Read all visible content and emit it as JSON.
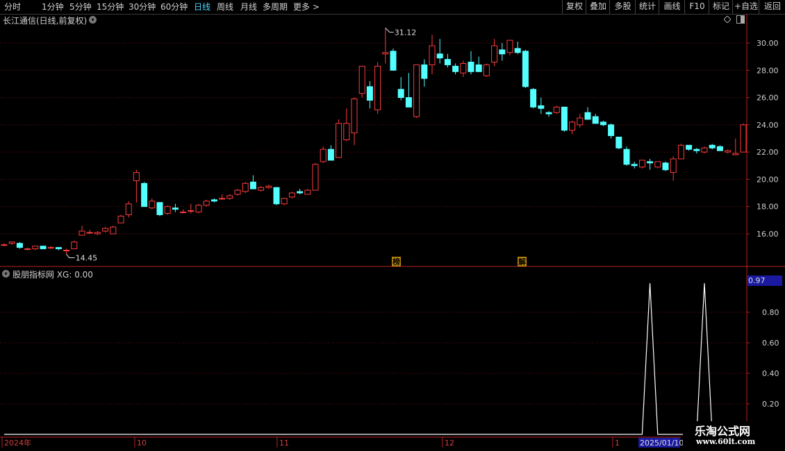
{
  "toolbar": {
    "periods": [
      "分时",
      "1分钟",
      "5分钟",
      "15分钟",
      "30分钟",
      "60分钟",
      "日线",
      "周线",
      "月线",
      "多周期",
      "更多 >"
    ],
    "active_period": "日线",
    "buttons": [
      "复权",
      "叠加",
      "多股",
      "统计",
      "画线",
      "F10",
      "标记",
      "+自选",
      "返回"
    ]
  },
  "chart": {
    "title": "长江通信(日线,前复权)",
    "y_ticks": [
      "30.00",
      "28.00",
      "26.00",
      "24.00",
      "22.00",
      "20.00",
      "18.00",
      "16.00"
    ],
    "high_label": "31.12",
    "low_label": "14.45",
    "marker_bang": "榜",
    "marker_jie": "解",
    "up_color": "#ff3c3c",
    "down_color": "#54ffff"
  },
  "indicator": {
    "title": "股朋指标网 XG: 0.00",
    "y_ticks": [
      "0.80",
      "0.60",
      "0.40",
      "0.20"
    ],
    "current_value": "0.97",
    "signal_values": [
      0,
      0,
      0,
      0,
      0,
      0,
      0,
      0,
      0,
      0,
      0,
      0,
      0,
      0,
      0,
      0,
      0,
      0,
      0,
      0,
      0,
      0,
      0,
      0,
      0,
      0,
      0,
      0,
      0,
      0,
      0,
      0,
      0,
      0,
      0,
      0,
      0,
      0,
      0,
      0,
      0,
      0,
      0,
      0,
      0,
      0,
      0,
      0,
      0,
      0,
      0,
      0,
      0,
      0,
      0,
      0,
      0,
      0,
      0,
      0,
      0,
      0,
      0,
      0,
      0,
      0,
      0,
      0,
      0,
      0,
      0,
      0,
      0,
      0,
      0,
      0,
      0,
      0,
      0,
      0,
      0,
      0,
      0,
      1,
      0,
      0,
      0,
      0,
      0,
      0,
      1,
      0,
      0,
      0,
      0,
      0,
      0,
      0,
      0,
      0
    ]
  },
  "x_axis": {
    "labels": [
      "2024年",
      "10",
      "11",
      "12",
      "1"
    ],
    "cursor_date": "2025/01/10"
  },
  "watermark": {
    "line1": "乐淘公式网",
    "line2": "www.60lt.com"
  },
  "chart_data": {
    "type": "candlestick",
    "ylim": [
      14.0,
      31.6
    ],
    "candles": [
      [
        15.2,
        15.3,
        15.1,
        15.2
      ],
      [
        15.3,
        15.4,
        15.2,
        15.4
      ],
      [
        15.3,
        15.4,
        14.9,
        15.0
      ],
      [
        14.9,
        15.0,
        14.8,
        14.9
      ],
      [
        14.9,
        15.1,
        14.8,
        15.1
      ],
      [
        15.1,
        15.1,
        14.9,
        14.9
      ],
      [
        15.0,
        15.1,
        14.9,
        15.0
      ],
      [
        15.0,
        15.0,
        14.8,
        14.9
      ],
      [
        14.8,
        14.9,
        14.5,
        14.8
      ],
      [
        14.9,
        15.5,
        14.9,
        15.4
      ],
      [
        15.9,
        16.6,
        15.9,
        16.2
      ],
      [
        16.1,
        16.3,
        16.0,
        16.1
      ],
      [
        16.0,
        16.2,
        15.9,
        16.1
      ],
      [
        16.2,
        16.5,
        16.1,
        16.4
      ],
      [
        16.0,
        16.6,
        16.0,
        16.5
      ],
      [
        16.8,
        17.4,
        16.8,
        17.3
      ],
      [
        17.4,
        18.4,
        17.2,
        18.2
      ],
      [
        19.9,
        20.7,
        18.3,
        20.5
      ],
      [
        19.7,
        19.8,
        18.0,
        18.0
      ],
      [
        17.9,
        18.6,
        17.8,
        18.4
      ],
      [
        18.3,
        18.3,
        17.3,
        17.4
      ],
      [
        17.5,
        18.1,
        17.4,
        18.0
      ],
      [
        17.9,
        18.2,
        17.6,
        17.8
      ],
      [
        17.6,
        17.8,
        17.5,
        17.6
      ],
      [
        17.7,
        18.2,
        17.5,
        17.7
      ],
      [
        17.6,
        18.2,
        17.5,
        18.1
      ],
      [
        18.1,
        18.5,
        18.0,
        18.4
      ],
      [
        18.5,
        18.6,
        18.3,
        18.4
      ],
      [
        18.6,
        18.9,
        18.5,
        18.6
      ],
      [
        18.6,
        18.9,
        18.5,
        18.8
      ],
      [
        18.9,
        19.3,
        18.8,
        19.2
      ],
      [
        19.1,
        19.8,
        19.0,
        19.7
      ],
      [
        19.8,
        20.3,
        19.5,
        19.3
      ],
      [
        19.2,
        19.5,
        19.1,
        19.4
      ],
      [
        19.4,
        19.6,
        19.3,
        19.5
      ],
      [
        19.4,
        19.4,
        18.1,
        18.2
      ],
      [
        18.2,
        18.6,
        18.1,
        18.6
      ],
      [
        18.7,
        19.1,
        18.6,
        19.0
      ],
      [
        19.1,
        19.3,
        18.9,
        19.0
      ],
      [
        18.9,
        19.3,
        18.9,
        19.2
      ],
      [
        19.2,
        21.2,
        19.2,
        21.1
      ],
      [
        21.3,
        22.4,
        21.2,
        22.2
      ],
      [
        22.2,
        22.5,
        21.8,
        21.4
      ],
      [
        21.6,
        24.4,
        21.6,
        24.1
      ],
      [
        22.9,
        25.2,
        22.8,
        24.1
      ],
      [
        23.4,
        26.0,
        22.5,
        25.9
      ],
      [
        26.3,
        28.3,
        26.0,
        28.3
      ],
      [
        26.8,
        27.2,
        25.2,
        25.8
      ],
      [
        25.1,
        28.6,
        24.8,
        28.3
      ],
      [
        29.2,
        31.1,
        28.5,
        29.3
      ],
      [
        29.4,
        29.6,
        28.2,
        28.0
      ],
      [
        26.6,
        27.5,
        25.8,
        26.0
      ],
      [
        26.0,
        27.8,
        25.5,
        25.3
      ],
      [
        24.6,
        28.4,
        24.5,
        28.4
      ],
      [
        28.4,
        28.8,
        26.8,
        27.4
      ],
      [
        28.4,
        30.6,
        27.7,
        29.8
      ],
      [
        29.2,
        30.3,
        28.5,
        28.9
      ],
      [
        28.8,
        29.2,
        28.2,
        28.4
      ],
      [
        28.3,
        28.5,
        27.7,
        27.9
      ],
      [
        27.8,
        28.7,
        27.5,
        28.5
      ],
      [
        28.6,
        29.4,
        27.7,
        27.9
      ],
      [
        28.4,
        29.0,
        27.9,
        27.9
      ],
      [
        27.6,
        28.5,
        27.5,
        28.4
      ],
      [
        28.6,
        30.3,
        28.3,
        29.8
      ],
      [
        29.5,
        30.0,
        28.7,
        29.2
      ],
      [
        29.3,
        30.2,
        29.1,
        30.2
      ],
      [
        29.6,
        30.1,
        29.2,
        29.3
      ],
      [
        29.4,
        29.5,
        26.7,
        26.8
      ],
      [
        26.6,
        26.7,
        25.2,
        25.3
      ],
      [
        25.4,
        26.0,
        24.8,
        25.2
      ],
      [
        24.9,
        25.0,
        24.6,
        24.8
      ],
      [
        24.9,
        25.4,
        24.8,
        25.3
      ],
      [
        25.3,
        25.3,
        23.5,
        23.6
      ],
      [
        23.6,
        24.3,
        23.3,
        24.2
      ],
      [
        24.0,
        24.8,
        23.8,
        24.5
      ],
      [
        24.9,
        25.3,
        24.5,
        24.4
      ],
      [
        24.6,
        24.8,
        24.1,
        24.1
      ],
      [
        24.2,
        24.3,
        23.9,
        24.0
      ],
      [
        24.0,
        24.1,
        23.0,
        23.2
      ],
      [
        23.1,
        23.1,
        22.2,
        22.3
      ],
      [
        22.2,
        22.4,
        21.0,
        21.1
      ],
      [
        21.1,
        21.3,
        20.8,
        21.0
      ],
      [
        20.9,
        21.4,
        20.8,
        21.4
      ],
      [
        21.3,
        21.5,
        20.7,
        21.2
      ],
      [
        20.9,
        21.3,
        20.8,
        21.3
      ],
      [
        21.2,
        21.3,
        20.6,
        20.7
      ],
      [
        20.5,
        21.7,
        19.9,
        21.5
      ],
      [
        21.5,
        22.6,
        21.5,
        22.5
      ],
      [
        22.5,
        22.5,
        22.1,
        22.2
      ],
      [
        22.2,
        22.3,
        21.9,
        22.1
      ],
      [
        22.0,
        22.4,
        21.9,
        22.3
      ],
      [
        22.5,
        22.6,
        22.2,
        22.3
      ],
      [
        22.4,
        22.5,
        22.1,
        22.1
      ],
      [
        22.0,
        22.2,
        21.9,
        22.1
      ],
      [
        21.8,
        23.0,
        21.8,
        21.9
      ],
      [
        22.0,
        24.1,
        22.0,
        24.0
      ]
    ]
  }
}
